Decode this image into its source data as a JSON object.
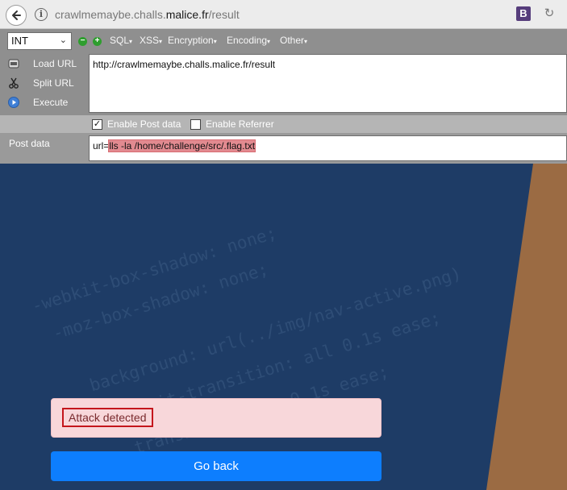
{
  "browser": {
    "url_path": "crawlmemaybe.challs.",
    "url_host": "malice.fr",
    "url_rest": "/result",
    "extension_label": "B"
  },
  "hackbar": {
    "select_value": "INT",
    "menus": [
      "SQL",
      "XSS",
      "Encryption",
      "Encoding",
      "Other"
    ],
    "actions": [
      "Load URL",
      "Split URL",
      "Execute"
    ],
    "url_value": "http://crawlmemaybe.challs.malice.fr/result",
    "enable_post_label": "Enable Post data",
    "enable_post_checked": true,
    "enable_referrer_label": "Enable Referrer",
    "enable_referrer_checked": false,
    "post_label": "Post data",
    "post_prefix": "url=",
    "post_payload": "lls -la /home/challenge/src/.flag.txt"
  },
  "page": {
    "alert_text": "Attack detected",
    "button_label": "Go back",
    "code_lines": [
      "-webkit-box-shadow: none;",
      "-moz-box-shadow: none;",
      "background: url(../img/nav-active.png)",
      "-webkit-transition: all 0.1s ease;",
      "transition: all 0.1s ease;"
    ]
  },
  "colors": {
    "page_bg": "#1e3c66",
    "alert_bg": "#f8d7da",
    "button_bg": "#0d7efe",
    "highlight": "#e28a90"
  }
}
